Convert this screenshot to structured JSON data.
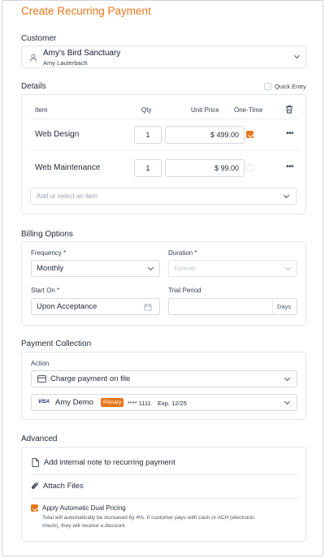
{
  "title": "Create Recurring Payment",
  "customer": {
    "section_label": "Customer",
    "name": "Amy's Bird Sanctuary",
    "contact": "Amy Lauterbach"
  },
  "details": {
    "section_label": "Details",
    "quick_entry_label": "Quick Entry",
    "quick_entry_checked": false,
    "columns": {
      "item": "Item",
      "qty": "Qty",
      "unit_price": "Unit Price",
      "one_time": "One-Time"
    },
    "rows": [
      {
        "item": "Web Design",
        "qty": "1",
        "unit_price": "$ 499.00",
        "one_time": true
      },
      {
        "item": "Web Maintenance",
        "qty": "1",
        "unit_price": "$ 99.00",
        "one_time": false
      }
    ],
    "add_item_placeholder": "Add or select an item"
  },
  "billing": {
    "section_label": "Billing Options",
    "frequency_label": "Frequency *",
    "frequency_value": "Monthly",
    "duration_label": "Duration *",
    "duration_placeholder": "Forever",
    "start_label": "Start On *",
    "start_value": "Upon Acceptance",
    "trial_label": "Trial Period",
    "trial_value": "",
    "trial_suffix": "Days"
  },
  "payment": {
    "section_label": "Payment Collection",
    "action_label": "Action",
    "action_value": "Charge payment on file",
    "card_brand": "VISA",
    "card_name": "Amy Demo",
    "card_badge": "Primary",
    "card_number": "**** 1111",
    "card_exp": "Exp. 12/25"
  },
  "advanced": {
    "section_label": "Advanced",
    "note_label": "Add internal note to recurring payment",
    "attach_label": "Attach Files",
    "dual_pricing_label": "Apply Automatic Dual Pricing",
    "dual_pricing_checked": true,
    "dual_pricing_desc_line1": "Total will automatically be increased by 4%. If customer pays with cash or ACH (electronic",
    "dual_pricing_desc_line2": "check), they will receive a discount."
  },
  "colors": {
    "accent": "#e8761e",
    "border": "#e5e7eb",
    "text": "#1f2937"
  }
}
